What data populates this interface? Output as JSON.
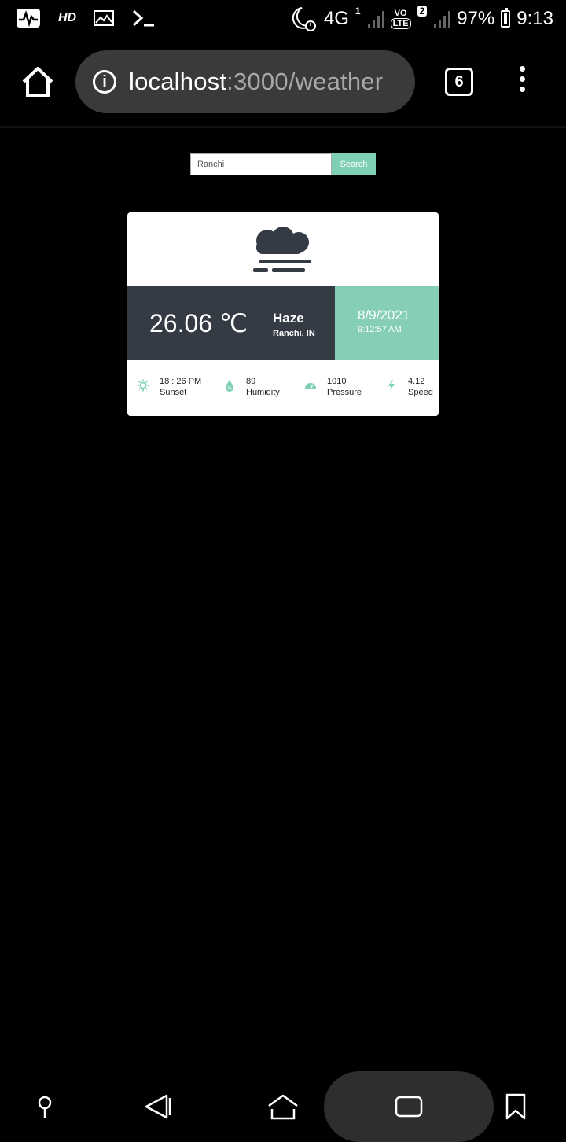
{
  "status_bar": {
    "hd_label": "HD",
    "network": "4G",
    "sim1_label": "1",
    "volte_top": "VO",
    "volte_bottom": "LTE",
    "sim2_label": "2",
    "battery": "97%",
    "time": "9:13",
    "icons": [
      "activity-icon",
      "hd-icon",
      "gallery-icon",
      "terminal-icon",
      "moon-alarm-icon",
      "signal-icon",
      "battery-icon"
    ]
  },
  "browser": {
    "url_host": "localhost",
    "url_rest": ":3000/weather",
    "tab_count": "6",
    "icons": [
      "home-icon",
      "info-icon",
      "tabs-icon",
      "menu-icon"
    ]
  },
  "search": {
    "value": "Ranchi",
    "button_label": "Search"
  },
  "weather": {
    "icon": "haze-icon",
    "temperature": "26.06 ℃",
    "condition": "Haze",
    "location": "Ranchi, IN",
    "date": "8/9/2021",
    "time": "9:12:57 AM",
    "stats": [
      {
        "icon": "sunset-icon",
        "value": "18 : 26 PM",
        "label": "Sunset"
      },
      {
        "icon": "humidity-icon",
        "value": "89",
        "label": "Humidity"
      },
      {
        "icon": "pressure-icon",
        "value": "1010",
        "label": "Pressure"
      },
      {
        "icon": "wind-speed-icon",
        "value": "4.12",
        "label": "Speed"
      }
    ],
    "colors": {
      "dark": "#353b44",
      "accent": "#86cfb6",
      "icon_accent": "#7fcfb5"
    }
  },
  "nav_bar": {
    "icons": [
      "pin-icon",
      "back-icon",
      "home-nav-icon",
      "recents-icon",
      "bookmark-icon"
    ]
  }
}
